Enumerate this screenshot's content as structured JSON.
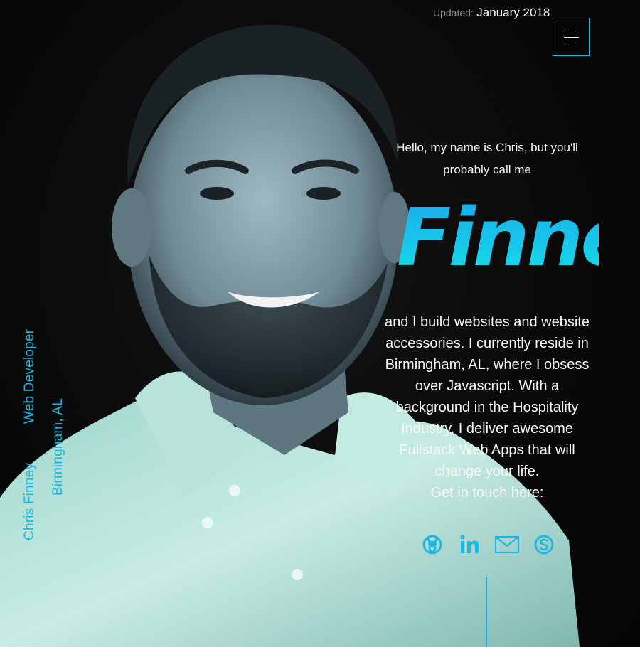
{
  "header": {
    "updated_label": "Updated:",
    "updated_value": "January 2018",
    "menu_icon": "hamburger-menu-icon"
  },
  "intro": {
    "greeting": "Hello, my name is Chris, but you'll probably call me",
    "nickname": "Finney",
    "bio": "and I build websites and website accessories. I currently reside in Birmingham, AL, where I obsess over Javascript. With a background in the Hospitality Industry, I deliver awesome Fullstack Web Apps that will change your life.",
    "cta": "Get in touch here:"
  },
  "socials": [
    {
      "icon": "github-icon",
      "label": "GitHub"
    },
    {
      "icon": "linkedin-icon",
      "label": "LinkedIn"
    },
    {
      "icon": "email-icon",
      "label": "Email"
    },
    {
      "icon": "skype-icon",
      "label": "Skype"
    }
  ],
  "side": {
    "name": "Chris Finney",
    "role": "Web Developer",
    "location": "Birmingham, AL"
  },
  "colors": {
    "accent": "#1fb8e4",
    "background": "#0a0a0a",
    "text": "#f5f5f5",
    "muted": "#8d8d8d"
  }
}
